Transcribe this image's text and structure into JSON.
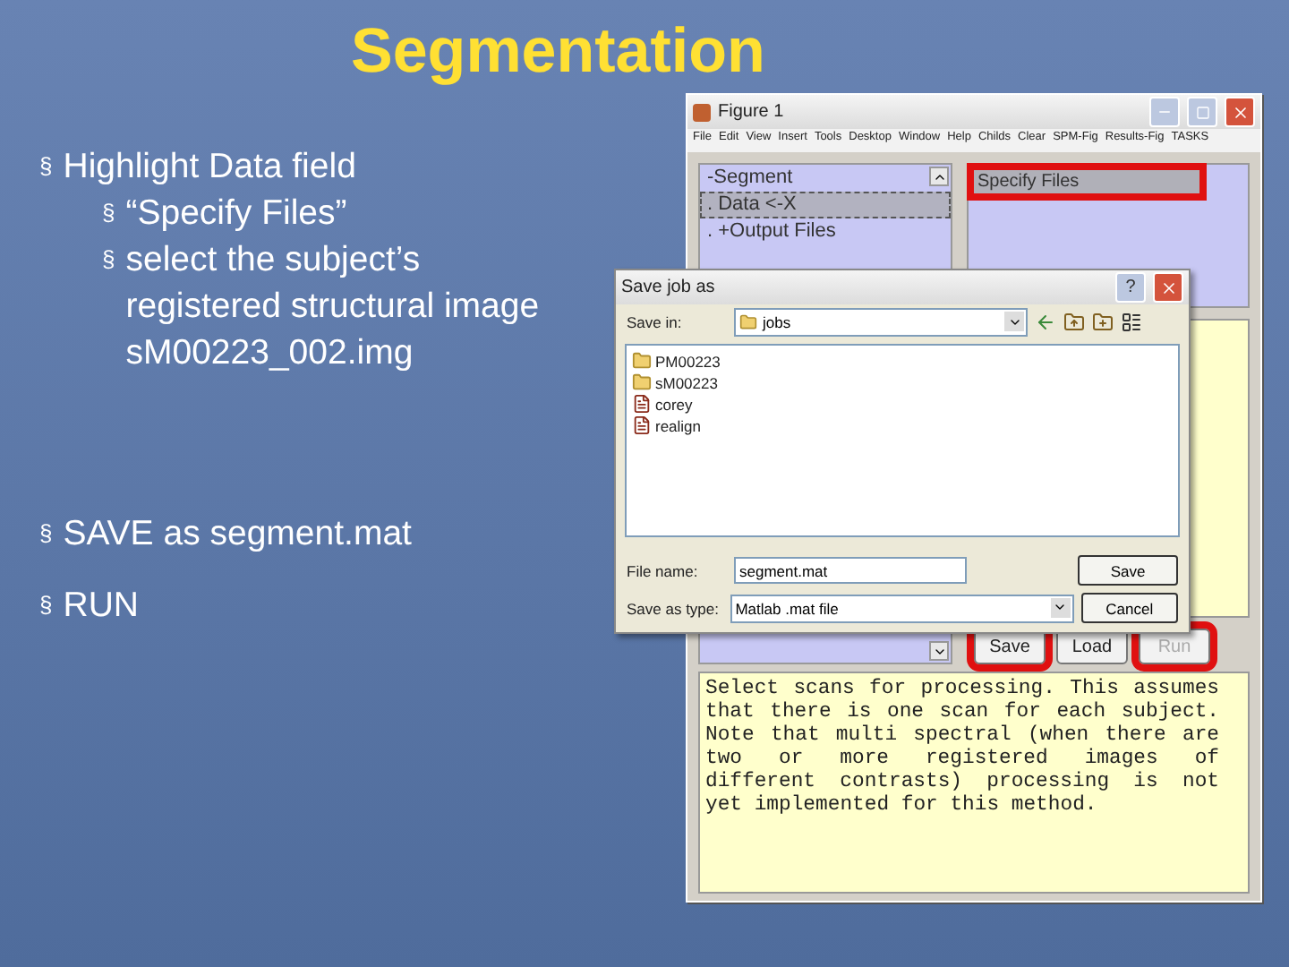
{
  "title": "Segmentation",
  "bullets": [
    {
      "marker": "§",
      "text": "Highlight Data field",
      "children": [
        {
          "marker": "§",
          "text": "“Specify Files”"
        },
        {
          "marker": "§",
          "text": "select the subject’s registered structural image sM00223_002.img"
        }
      ]
    },
    {
      "marker": "§",
      "text": "SAVE as segment.mat"
    },
    {
      "marker": "§",
      "text": "RUN"
    }
  ],
  "figure_window": {
    "title": "Figure 1",
    "menu": [
      "File",
      "Edit",
      "View",
      "Insert",
      "Tools",
      "Desktop",
      "Window",
      "Help",
      "Childs",
      "Clear",
      "SPM-Fig",
      "Results-Fig",
      "TASKS"
    ],
    "tree": [
      {
        "text": "-Segment",
        "selected": false
      },
      {
        "text": ". Data <-X",
        "selected": true
      },
      {
        "text": ". +Output Files",
        "selected": false
      }
    ],
    "options": [
      {
        "text": "Specify Files",
        "selected": true,
        "highlighted": true
      }
    ],
    "buttons": [
      {
        "label": "Save",
        "highlighted": true,
        "disabled": false
      },
      {
        "label": "Load",
        "highlighted": false,
        "disabled": false
      },
      {
        "label": "Run",
        "highlighted": true,
        "disabled": true
      }
    ],
    "help": "Select scans for processing. This assumes that there is one scan for each subject. Note that multi spectral (when there are two or more registered images of different contrasts) processing is not yet implemented for this method."
  },
  "dialog": {
    "title": "Save job as",
    "help_button": "?",
    "save_in_label": "Save in:",
    "save_in": "jobs",
    "files": [
      {
        "name": "PM00223",
        "kind": "folder"
      },
      {
        "name": "sM00223",
        "kind": "folder"
      },
      {
        "name": "corey",
        "kind": "file"
      },
      {
        "name": "realign",
        "kind": "file"
      }
    ],
    "file_name_label": "File name:",
    "file_name": "segment.mat",
    "type_label": "Save as type:",
    "type": "Matlab .mat file",
    "buttons": [
      "Save",
      "Cancel"
    ]
  }
}
